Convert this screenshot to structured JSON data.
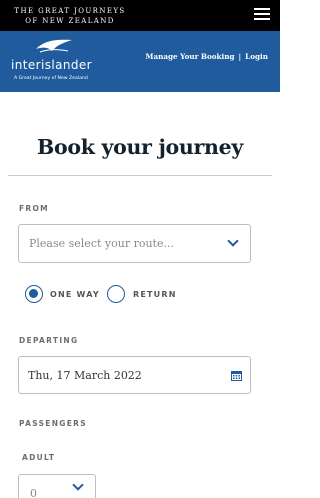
{
  "top_brand": {
    "line1": "THE GREAT JOURNEYS",
    "line2": "OF NEW ZEALAND"
  },
  "header": {
    "logo_text": "interislander",
    "tagline": "A Great Journey of New Zealand",
    "manage_booking_label": "Manage Your Booking",
    "separator": "|",
    "login_label": "Login"
  },
  "main": {
    "title": "Book your journey",
    "from_label": "FROM",
    "route_placeholder": "Please select your route...",
    "trip_type": {
      "one_way_label": "ONE WAY",
      "return_label": "RETURN",
      "selected": "one_way"
    },
    "departing_label": "DEPARTING",
    "departing_value": "Thu, 17 March 2022",
    "passengers_label": "PASSENGERS",
    "adult_label": "ADULT",
    "adult_value": "0"
  },
  "colors": {
    "header_blue": "#1f5b9d",
    "top_black": "#000000",
    "title_dark": "#14222e"
  }
}
